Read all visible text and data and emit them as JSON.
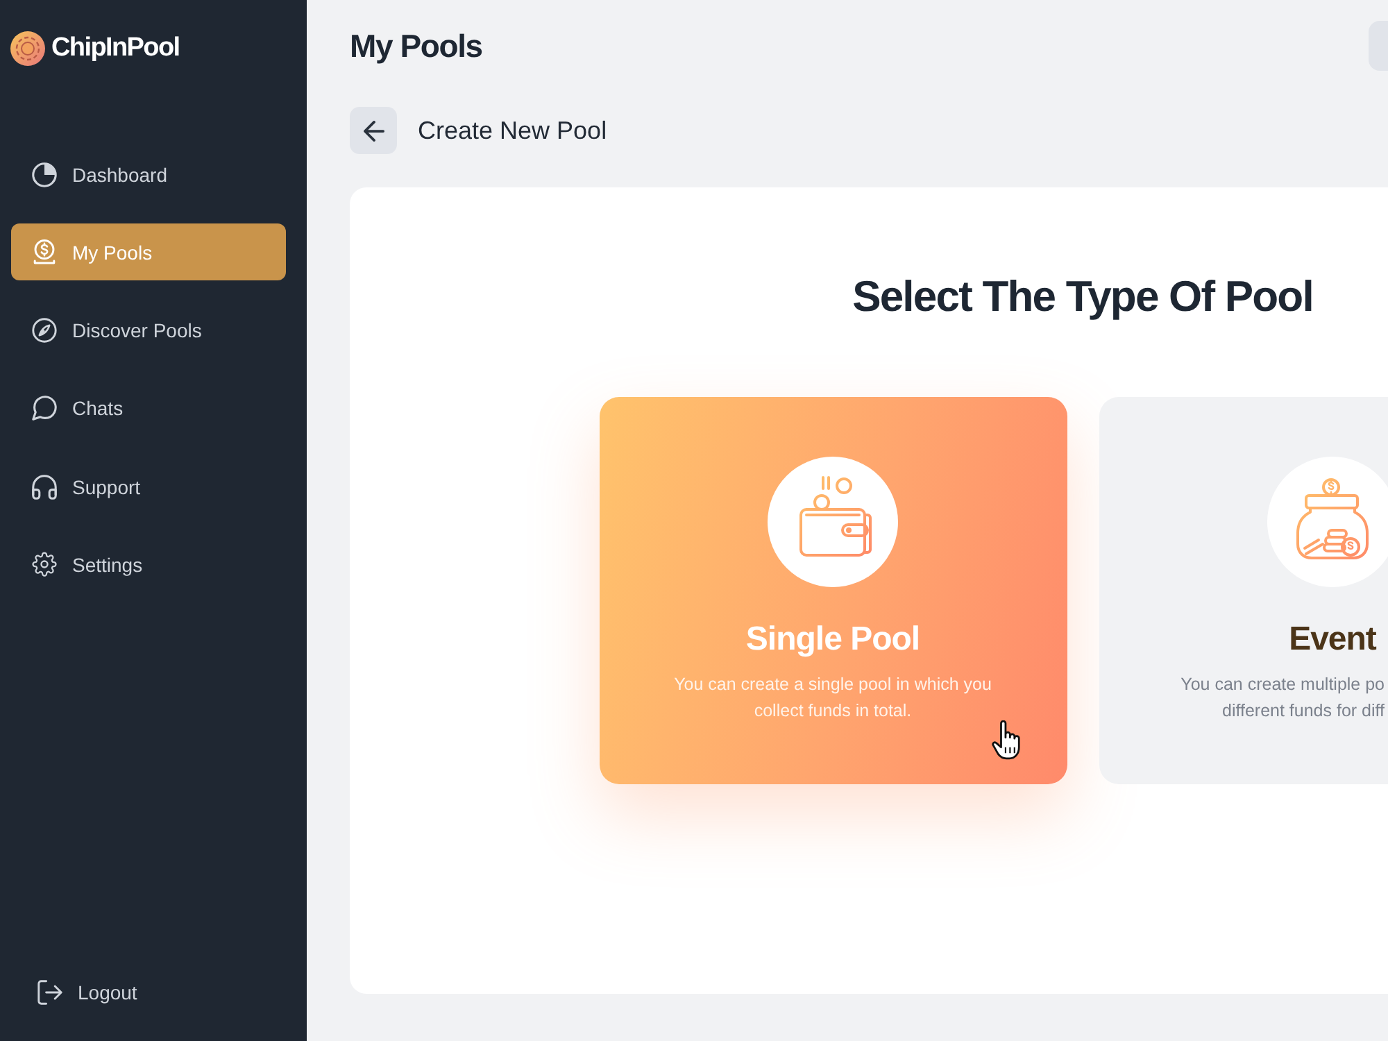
{
  "sidebar": {
    "logo": "ChipInPool",
    "items": [
      {
        "label": "Dashboard",
        "selected": false
      },
      {
        "label": "My Pools",
        "selected": true
      },
      {
        "label": "Discover Pools",
        "selected": false
      },
      {
        "label": "Chats",
        "selected": false
      },
      {
        "label": "Support",
        "selected": false
      },
      {
        "label": "Settings",
        "selected": false
      }
    ],
    "logout": "Logout"
  },
  "header": {
    "title": "My Pools"
  },
  "subheader": {
    "title": "Create New Pool"
  },
  "panel": {
    "title": "Select The Type Of Pool",
    "cards": [
      {
        "title": "Single Pool",
        "description_lines": [
          "You can create a single pool in which you",
          "collect funds in total."
        ],
        "selected": true
      },
      {
        "title": "Event",
        "description_lines": [
          "You can create multiple po",
          "different funds for diff"
        ],
        "selected": false
      }
    ]
  }
}
